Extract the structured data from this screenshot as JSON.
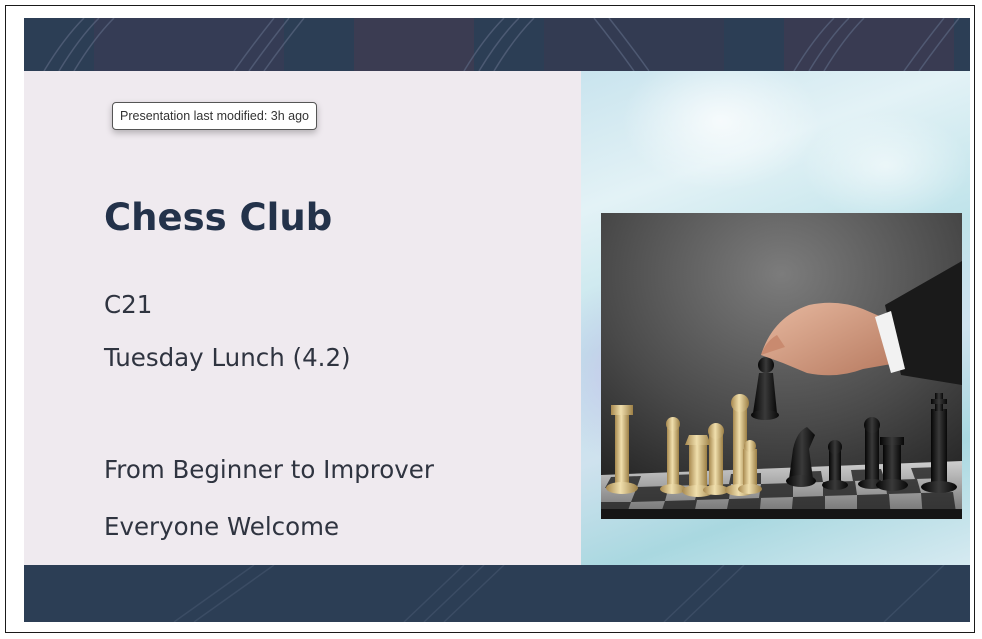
{
  "tooltip": {
    "text": "Presentation last modified: 3h ago"
  },
  "slide": {
    "title": "Chess Club",
    "room": "C21",
    "session": "Tuesday Lunch (4.2)",
    "level": "From Beginner to Improver",
    "welcome": "Everyone Welcome"
  },
  "colors": {
    "band": "#2c3e55",
    "title": "#23324a",
    "panel": "#efeaef"
  },
  "icons": {
    "photo": "chess-photo"
  }
}
